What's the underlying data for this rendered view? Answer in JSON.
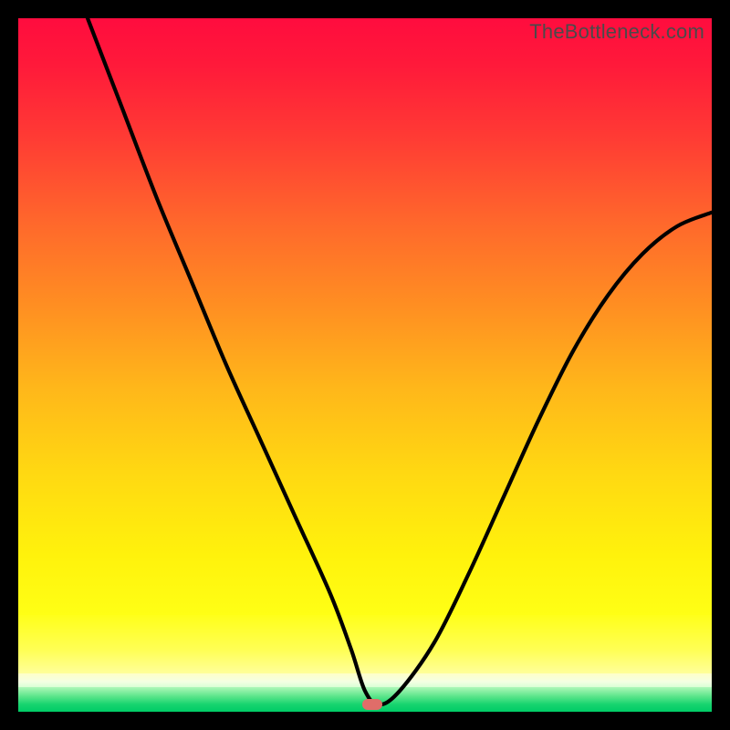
{
  "watermark": "TheBottleneck.com",
  "chart_data": {
    "type": "line",
    "title": "",
    "xlabel": "",
    "ylabel": "",
    "xlim": [
      0,
      100
    ],
    "ylim": [
      0,
      100
    ],
    "grid": false,
    "legend": false,
    "series": [
      {
        "name": "curve",
        "x": [
          10,
          15,
          20,
          25,
          30,
          35,
          40,
          45,
          48,
          50,
          52,
          55,
          60,
          65,
          70,
          75,
          80,
          85,
          90,
          95,
          100
        ],
        "y": [
          100,
          87,
          74,
          62,
          50,
          39,
          28,
          17,
          9,
          3,
          1,
          3,
          10,
          20,
          31,
          42,
          52,
          60,
          66,
          70,
          72
        ]
      }
    ],
    "marker": {
      "x": 51,
      "y": 1,
      "color": "#e06d69"
    },
    "background_bands": [
      {
        "from_y": 100,
        "to_y": 14,
        "gradient": "red-to-yellow"
      },
      {
        "from_y": 14,
        "to_y": 5.5,
        "gradient": "yellow-slab"
      },
      {
        "from_y": 5.5,
        "to_y": 3.5,
        "gradient": "pale"
      },
      {
        "from_y": 3.5,
        "to_y": 0,
        "gradient": "green"
      }
    ]
  }
}
